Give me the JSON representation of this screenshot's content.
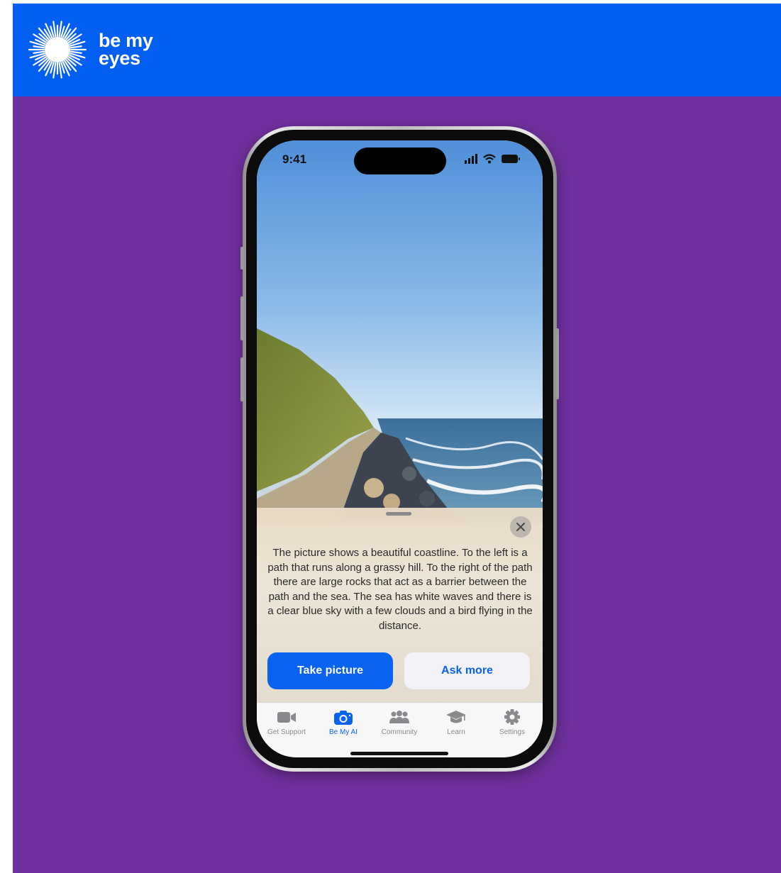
{
  "brand": {
    "name_line1": "be my",
    "name_line2": "eyes",
    "bar_color": "#005ef0",
    "background_color": "#70309d"
  },
  "phone": {
    "status_time": "9:41",
    "icons": [
      "signal-icon",
      "wifi-icon",
      "battery-icon"
    ]
  },
  "sheet": {
    "description": "The picture shows a beautiful coastline. To the left is a path that runs along a grassy hill. To the right of the path there are large rocks that act as a barrier between the path and the sea. The sea has white waves and there is a clear blue sky with a few clouds and a bird flying in the distance.",
    "primary_button": "Take picture",
    "secondary_button": "Ask more",
    "accent_color": "#0a62f0"
  },
  "tabbar": {
    "items": [
      {
        "label": "Get Support",
        "icon": "video-camera-icon"
      },
      {
        "label": "Be My AI",
        "icon": "camera-icon",
        "active": true
      },
      {
        "label": "Community",
        "icon": "people-icon"
      },
      {
        "label": "Learn",
        "icon": "graduation-cap-icon"
      },
      {
        "label": "Settings",
        "icon": "gear-icon"
      }
    ]
  }
}
